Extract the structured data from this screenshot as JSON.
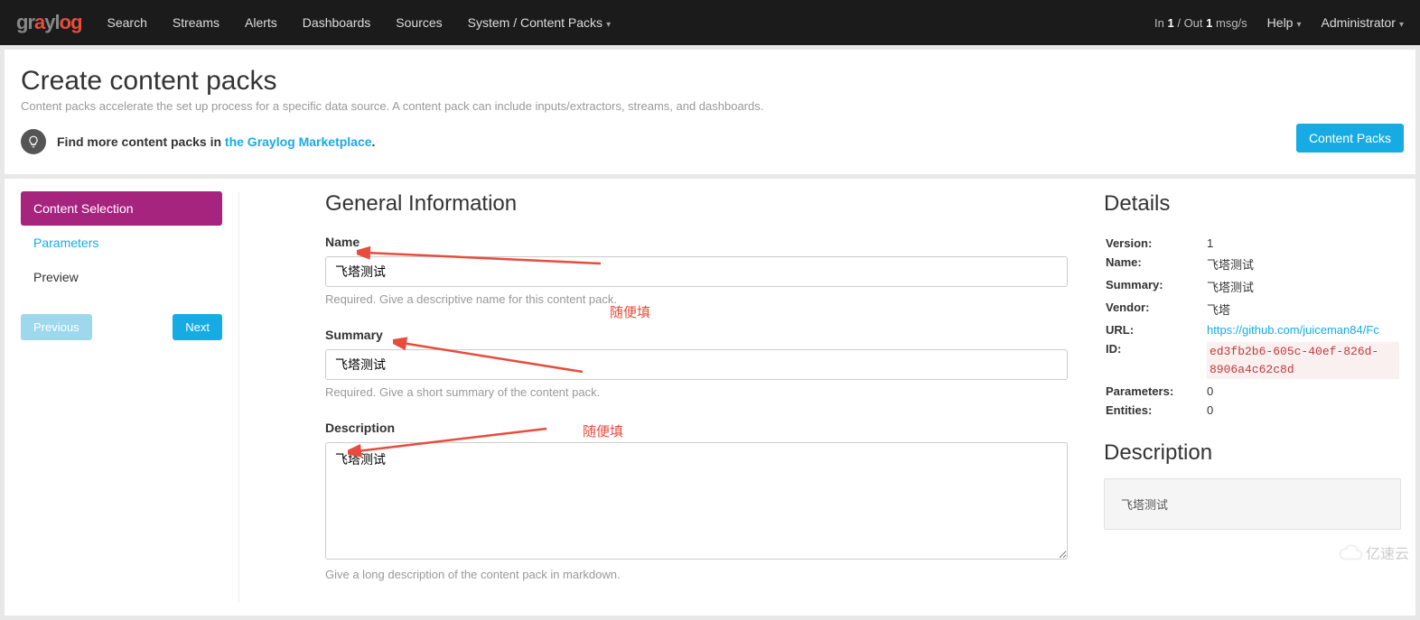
{
  "nav": {
    "items": [
      "Search",
      "Streams",
      "Alerts",
      "Dashboards",
      "Sources",
      "System / Content Packs"
    ],
    "iostats_prefix": "In ",
    "iostats_in": "1",
    "iostats_mid": " / Out ",
    "iostats_out": "1",
    "iostats_suffix": " msg/s",
    "help": "Help",
    "admin": "Administrator"
  },
  "header": {
    "title": "Create content packs",
    "desc": "Content packs accelerate the set up process for a specific data source. A content pack can include inputs/extractors, streams, and dashboards.",
    "hint_pre": "Find more content packs in ",
    "hint_link": "the Graylog Marketplace",
    "hint_post": ".",
    "btn": "Content Packs"
  },
  "sidebar": {
    "items": [
      {
        "label": "Content Selection",
        "active": true
      },
      {
        "label": "Parameters",
        "plain": true
      },
      {
        "label": "Preview",
        "plain": false
      }
    ],
    "prev": "Previous",
    "next": "Next"
  },
  "form": {
    "heading": "General Information",
    "name": {
      "label": "Name",
      "value": "飞塔测试",
      "help": "Required. Give a descriptive name for this content pack."
    },
    "summary": {
      "label": "Summary",
      "value": "飞塔测试",
      "help": "Required. Give a short summary of the content pack."
    },
    "description": {
      "label": "Description",
      "value": "飞塔测试",
      "help": "Give a long description of the content pack in markdown."
    }
  },
  "details": {
    "heading": "Details",
    "rows": {
      "Version:": "1",
      "Name:": "飞塔测试",
      "Summary:": "飞塔测试",
      "Vendor:": "飞塔",
      "URL:": "https://github.com/juiceman84/Fc",
      "ID:": "ed3fb2b6-605c-40ef-826d-8906a4c62c8d",
      "Parameters:": "0",
      "Entities:": "0"
    },
    "desc_heading": "Description",
    "desc_body": "飞塔测试"
  },
  "annotations": {
    "a1": "随便填",
    "a2": "随便填"
  },
  "watermark": "亿速云"
}
